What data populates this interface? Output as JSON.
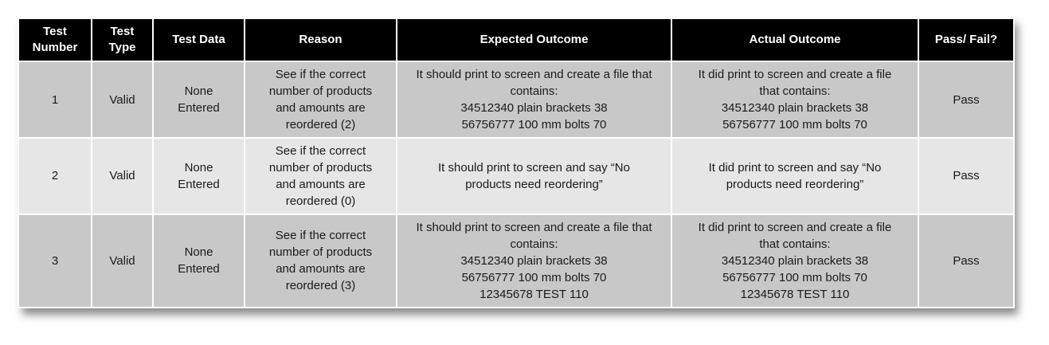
{
  "headers": {
    "test_number": [
      "Test",
      "Number"
    ],
    "test_type": [
      "Test",
      "Type"
    ],
    "test_data": "Test Data",
    "reason": "Reason",
    "expected": "Expected Outcome",
    "actual": "Actual Outcome",
    "pass_fail": "Pass/ Fail?"
  },
  "rows": [
    {
      "number": "1",
      "type": "Valid",
      "data": [
        "None",
        "Entered"
      ],
      "reason": [
        "See if the correct",
        "number of products",
        "and amounts are",
        "reordered (2)"
      ],
      "expected": [
        "It should print to screen and create a file that",
        "contains:",
        "34512340 plain brackets 38",
        "56756777 100 mm bolts 70"
      ],
      "actual": [
        "It did print to screen and create a file",
        "that contains:",
        "34512340 plain brackets 38",
        "56756777 100 mm bolts 70"
      ],
      "result": "Pass"
    },
    {
      "number": "2",
      "type": "Valid",
      "data": [
        "None",
        "Entered"
      ],
      "reason": [
        "See if the correct",
        "number of products",
        "and amounts are",
        "reordered (0)"
      ],
      "expected": [
        "It should print to screen and say “No",
        "products need reordering”"
      ],
      "actual": [
        "It did print to screen and say “No",
        "products need reordering”"
      ],
      "result": "Pass"
    },
    {
      "number": "3",
      "type": "Valid",
      "data": [
        "None",
        "Entered"
      ],
      "reason": [
        "See if the correct",
        "number of products",
        "and amounts are",
        "reordered (3)"
      ],
      "expected": [
        "It should print to screen and create a file that",
        "contains:",
        "34512340 plain brackets 38",
        "56756777 100 mm bolts 70",
        "12345678 TEST 110"
      ],
      "actual": [
        "It did print to screen and create a file",
        "that contains:",
        "34512340 plain brackets 38",
        "56756777 100 mm bolts 70",
        "12345678 TEST 110"
      ],
      "result": "Pass"
    }
  ]
}
